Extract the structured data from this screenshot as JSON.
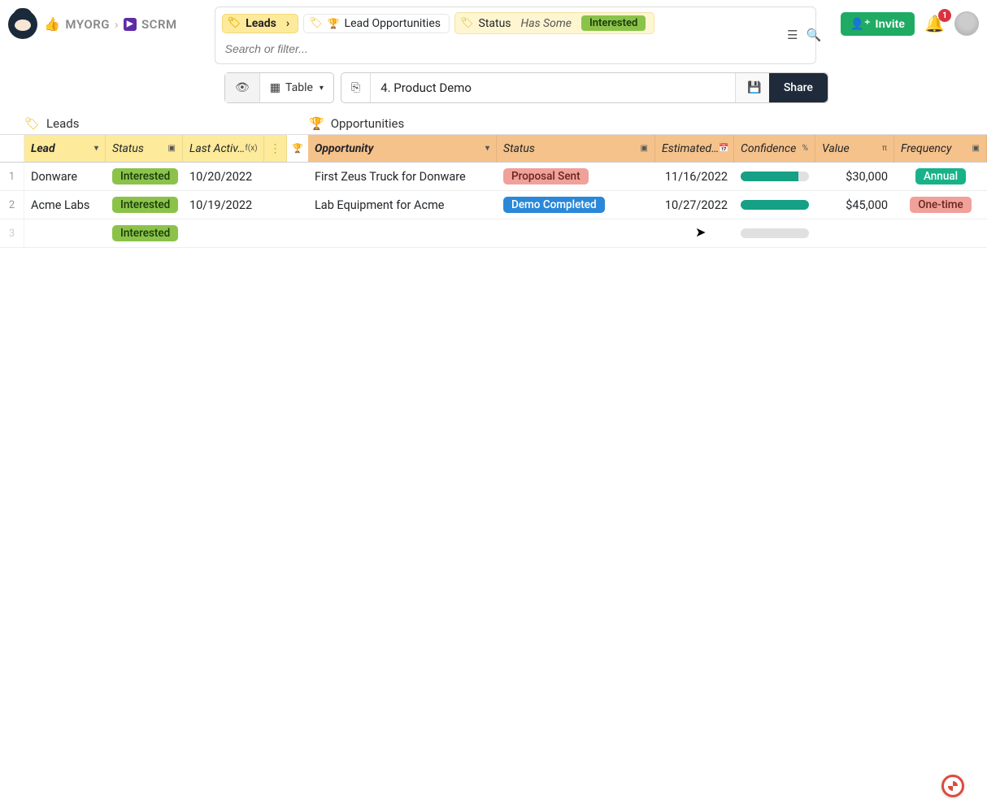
{
  "breadcrumb": {
    "org": "MYORG",
    "workspace": "SCRM"
  },
  "filter": {
    "root_chip": "Leads",
    "relation_chip": "Lead Opportunities",
    "condition": {
      "field": "Status",
      "predicate": "Has Some",
      "value": "Interested"
    },
    "search_placeholder": "Search or filter..."
  },
  "toolbar": {
    "view_mode": "Table",
    "view_name": "4. Product Demo",
    "share_label": "Share"
  },
  "topright": {
    "invite": "Invite",
    "notification_count": "1"
  },
  "sections": {
    "leads_label": "Leads",
    "opps_label": "Opportunities"
  },
  "columns": {
    "lead": "Lead",
    "lead_status": "Status",
    "last_activity": "Last Activ…",
    "opportunity": "Opportunity",
    "opp_status": "Status",
    "estimated": "Estimated…",
    "confidence": "Confidence",
    "value": "Value",
    "frequency": "Frequency"
  },
  "rows": [
    {
      "n": "1",
      "lead": "Donware",
      "lead_status": "Interested",
      "last_activity": "10/20/2022",
      "opportunity": "First Zeus Truck for Donware",
      "opp_status": "Proposal Sent",
      "opp_status_class": "proposal",
      "estimated": "11/16/2022",
      "confidence_pct": 85,
      "value": "$30,000",
      "frequency": "Annual",
      "frequency_class": "annual"
    },
    {
      "n": "2",
      "lead": "Acme Labs",
      "lead_status": "Interested",
      "last_activity": "10/19/2022",
      "opportunity": "Lab Equipment for Acme",
      "opp_status": "Demo Completed",
      "opp_status_class": "demo",
      "estimated": "10/27/2022",
      "confidence_pct": 100,
      "value": "$45,000",
      "frequency": "One-time",
      "frequency_class": "onetime"
    },
    {
      "n": "3",
      "lead": "",
      "lead_status": "Interested",
      "last_activity": "",
      "opportunity": "",
      "opp_status": "",
      "opp_status_class": "",
      "estimated": "",
      "confidence_pct": 0,
      "value": "",
      "frequency": "",
      "frequency_class": ""
    }
  ]
}
